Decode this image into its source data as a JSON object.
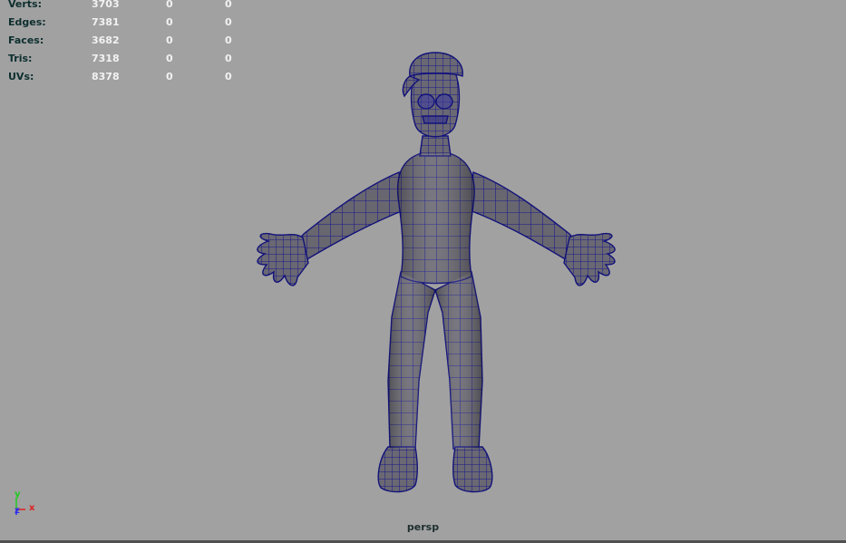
{
  "hud": {
    "rows": [
      {
        "label": "Verts:",
        "v1": "3703",
        "v2": "0",
        "v3": "0"
      },
      {
        "label": "Edges:",
        "v1": "7381",
        "v2": "0",
        "v3": "0"
      },
      {
        "label": "Faces:",
        "v1": "3682",
        "v2": "0",
        "v3": "0"
      },
      {
        "label": "Tris:",
        "v1": "7318",
        "v2": "0",
        "v3": "0"
      },
      {
        "label": "UVs:",
        "v1": "8378",
        "v2": "0",
        "v3": "0"
      }
    ]
  },
  "viewport": {
    "camera": "persp",
    "background_color": "#a1a1a1",
    "mesh_color": "#6a6872",
    "wire_color": "#16168a"
  },
  "axis_gizmo": {
    "y": {
      "label": "y",
      "color": "#22c922"
    },
    "z": {
      "label": "z",
      "color": "#2a2af0"
    },
    "x": {
      "label": "x",
      "color": "#e02020"
    }
  }
}
